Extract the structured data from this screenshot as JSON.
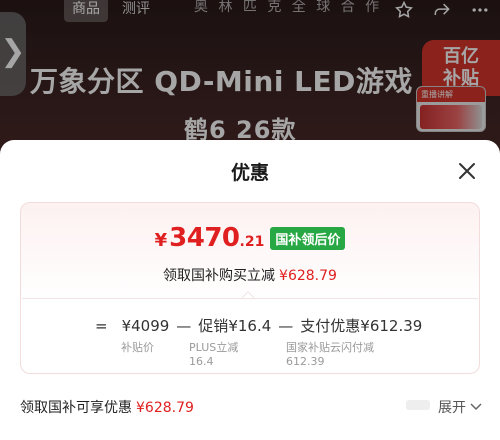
{
  "background": {
    "tabs": [
      "商品",
      "测评"
    ],
    "marquee": "奥 林 匹 克 全 球 合 作",
    "hero_title": "万象分区 QD-Mini LED游戏",
    "hero_subtitle": "鹤6  26款",
    "brand_badge": "百亿\n补贴",
    "ad_card_title": "重播讲解"
  },
  "sheet": {
    "title": "优惠",
    "final_price": {
      "currency": "¥",
      "integer": "3470",
      "decimal": ".21",
      "tag": "国补领后价"
    },
    "claim": {
      "label": "领取国补购买立减",
      "amount": "¥628.79"
    },
    "formula": {
      "eq": "=",
      "base_price": "¥4099",
      "minus1": "—",
      "promo_label": "促销",
      "promo_value": "¥16.4",
      "minus2": "—",
      "pay_label": "支付优惠",
      "pay_value": "¥612.39"
    },
    "labels": {
      "base": "补贴价",
      "promo_line1": "PLUS立减",
      "promo_line2": "16.4",
      "pay_line1": "国家补贴云闪付减",
      "pay_line2": "612.39"
    },
    "bottom": {
      "label": "领取国补可享优惠",
      "amount": "¥628.79",
      "expand": "展开"
    }
  },
  "colors": {
    "accent_red": "#e02020",
    "tag_green": "#28a745"
  }
}
